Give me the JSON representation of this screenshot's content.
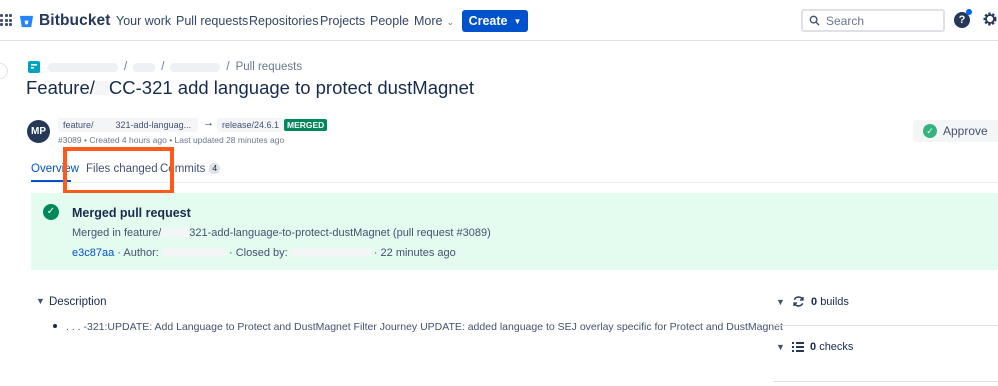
{
  "nav": {
    "product": "Bitbucket",
    "items": [
      "Your work",
      "Pull requests",
      "Repositories",
      "Projects",
      "People",
      "More"
    ],
    "create_label": "Create",
    "search_placeholder": "Search",
    "help_label": "?"
  },
  "breadcrumb": {
    "separator": "/",
    "current": "Pull requests"
  },
  "pr": {
    "title_prefix": "Feature/",
    "title_suffix": "CC-321 add language to protect dustMagnet",
    "author_initials": "MP",
    "source_prefix": "feature/",
    "source_suffix": "321-add-languag...",
    "arrow": "→",
    "target_branch": "release/24.6.1",
    "status": "MERGED",
    "meta": "#3089 • Created 4 hours ago • Last updated 28 minutes ago",
    "approve_label": "Approve"
  },
  "tabs": [
    {
      "label": "Overview",
      "active": true
    },
    {
      "label": "Files changed",
      "active": false
    },
    {
      "label": "Commits",
      "active": false,
      "count": "4"
    }
  ],
  "merged": {
    "heading": "Merged pull request",
    "line_prefix": "Merged in feature/",
    "line_suffix": "321-add-language-to-protect-dustMagnet (pull request #3089)",
    "commit_hash": "e3c87aa",
    "author_label": "· Author:",
    "closed_label": "· Closed by:",
    "time": "· 22 minutes ago"
  },
  "description": {
    "heading": "Description",
    "bullet": ". . . -321:UPDATE: Add Language to Protect and DustMagnet Filter Journey UPDATE: added language to SEJ overlay specific for Protect and DustMagnet"
  },
  "side": {
    "builds_count": "0",
    "builds_label": "builds",
    "checks_count": "0",
    "checks_label": "checks"
  },
  "colors": {
    "accent": "#0052cc",
    "merged_green": "#00875a",
    "merged_panel_bg": "#e3fcef",
    "highlight": "#ff5a1a"
  }
}
